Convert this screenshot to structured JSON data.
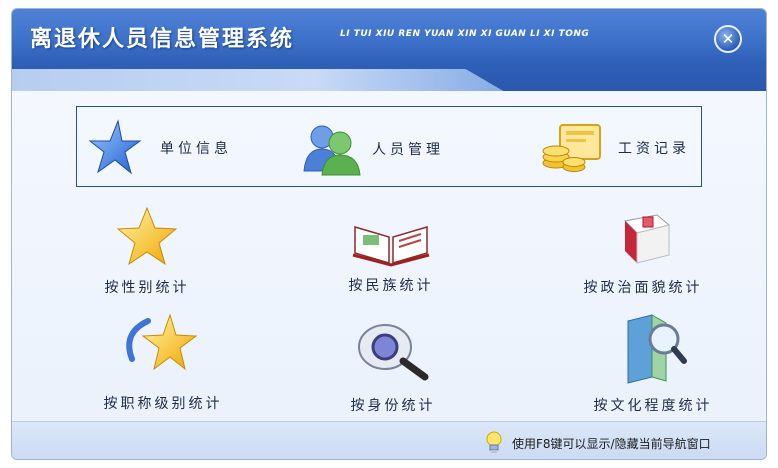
{
  "header": {
    "title": "离退休人员信息管理系统",
    "subtitle": "LI TUI XIU REN YUAN XIN XI GUAN LI XI TONG"
  },
  "top_nav": [
    {
      "label": "单位信息",
      "icon": "star-icon"
    },
    {
      "label": "人员管理",
      "icon": "users-icon"
    },
    {
      "label": "工资记录",
      "icon": "coins-icon"
    }
  ],
  "stats": [
    {
      "label": "按性别统计",
      "icon": "gold-star-icon"
    },
    {
      "label": "按民族统计",
      "icon": "book-icon"
    },
    {
      "label": "按政治面貌统计",
      "icon": "red-book-icon"
    },
    {
      "label": "按职称级别统计",
      "icon": "star-swirl-icon"
    },
    {
      "label": "按身份统计",
      "icon": "search-magnifier-icon"
    },
    {
      "label": "按文化程度统计",
      "icon": "document-search-icon"
    }
  ],
  "footer": {
    "hint": "使用F8键可以显示/隐藏当前导航窗口",
    "icon": "lightbulb-icon"
  },
  "colors": {
    "title_bar": "#3f73cb",
    "panel_border": "#2b4e8f",
    "text": "#1e2c48"
  }
}
